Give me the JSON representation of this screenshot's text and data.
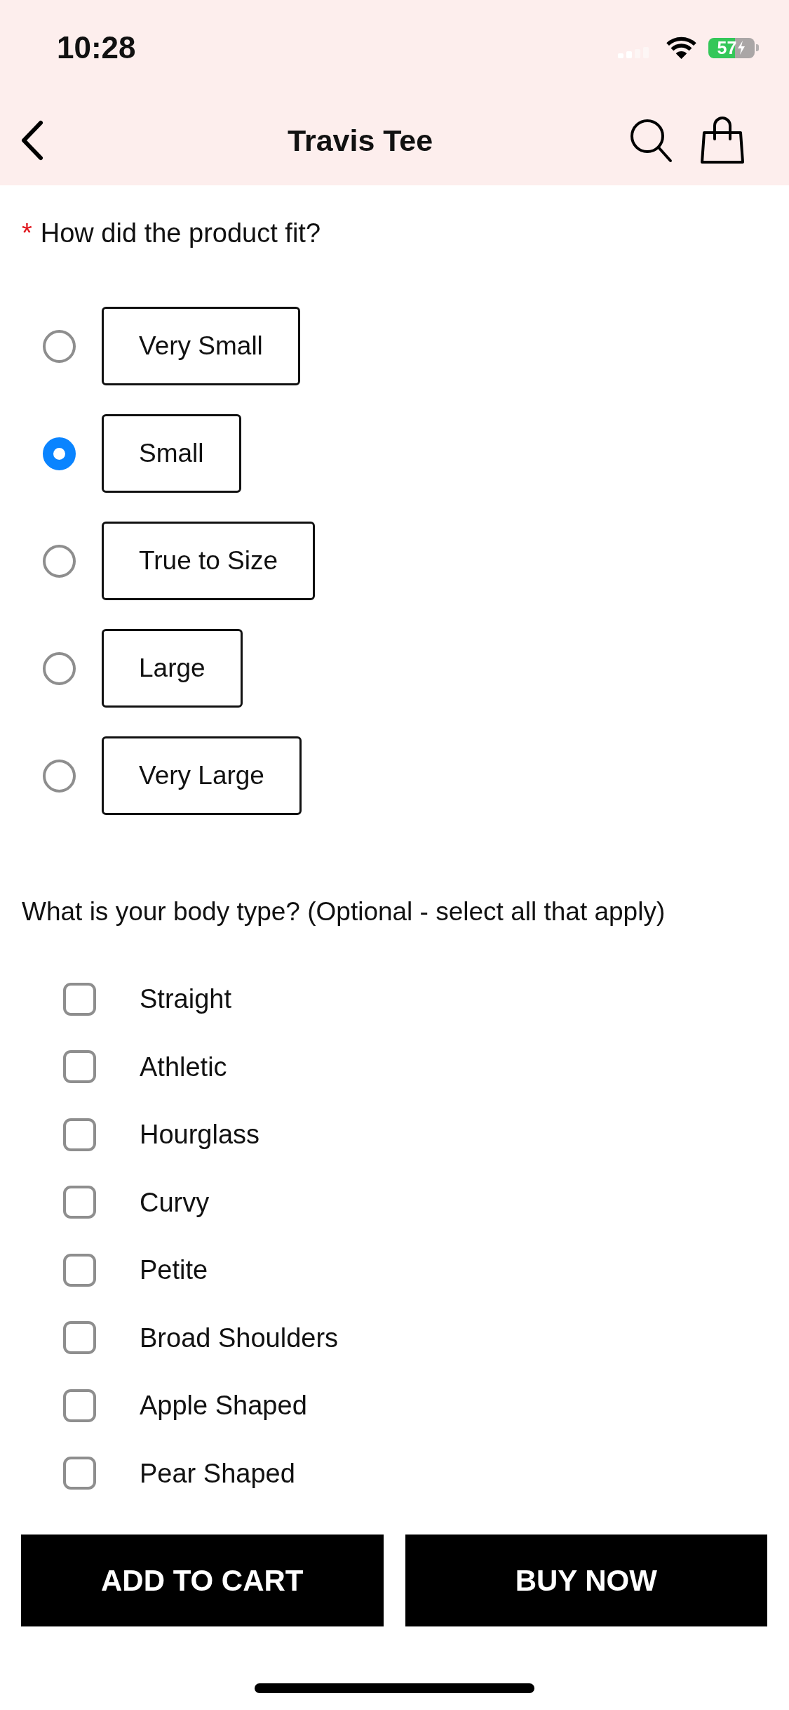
{
  "status_bar": {
    "time": "10:28",
    "battery": "57"
  },
  "header": {
    "title": "Travis Tee"
  },
  "fit_question": {
    "required_mark": "*",
    "label": "How did the product fit?",
    "options": [
      {
        "label": "Very Small",
        "selected": false
      },
      {
        "label": "Small",
        "selected": true
      },
      {
        "label": "True to Size",
        "selected": false
      },
      {
        "label": "Large",
        "selected": false
      },
      {
        "label": "Very Large",
        "selected": false
      }
    ]
  },
  "body_type_question": {
    "label": "What is your body type? (Optional - select all that apply)",
    "options": [
      {
        "label": "Straight",
        "checked": false
      },
      {
        "label": "Athletic",
        "checked": false
      },
      {
        "label": "Hourglass",
        "checked": false
      },
      {
        "label": "Curvy",
        "checked": false
      },
      {
        "label": "Petite",
        "checked": false
      },
      {
        "label": "Broad Shoulders",
        "checked": false
      },
      {
        "label": "Apple Shaped",
        "checked": false
      },
      {
        "label": "Pear Shaped",
        "checked": false
      }
    ]
  },
  "actions": [
    {
      "label": "ADD TO CART"
    },
    {
      "label": "BUY NOW"
    }
  ]
}
